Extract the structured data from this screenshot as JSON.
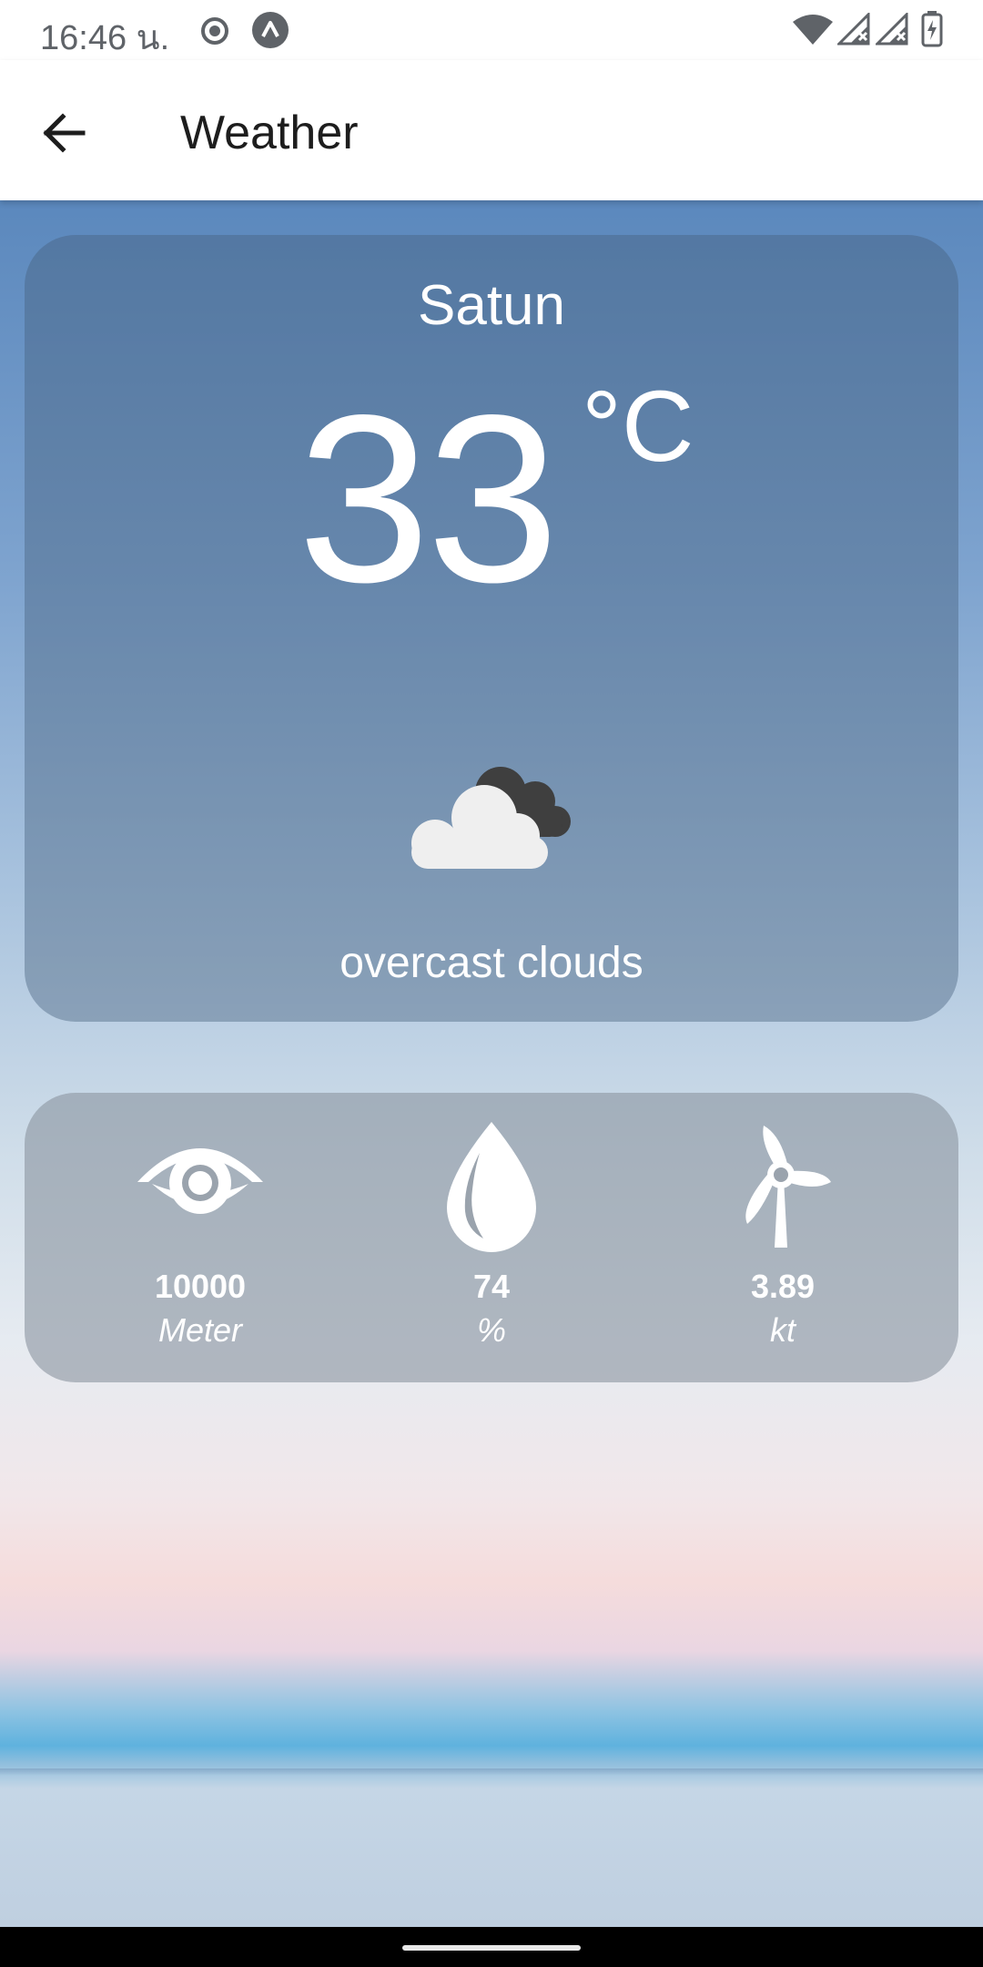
{
  "status_bar": {
    "time": "16:46 น.",
    "icons": [
      "record-icon",
      "vpn-arrow-icon",
      "wifi-icon",
      "signal-x-icon",
      "signal-x-icon",
      "battery-charging-icon"
    ]
  },
  "app_bar": {
    "title": "Weather",
    "back_icon": "arrow-left-icon"
  },
  "weather": {
    "city": "Satun",
    "temperature": "33",
    "unit": "°C",
    "condition_icon": "overcast-clouds-icon",
    "description": "overcast clouds"
  },
  "stats": [
    {
      "icon": "eye-icon",
      "value": "10000",
      "unit": "Meter"
    },
    {
      "icon": "water-drop-icon",
      "value": "74",
      "unit": "%"
    },
    {
      "icon": "wind-turbine-icon",
      "value": "3.89",
      "unit": "kt"
    }
  ],
  "colors": {
    "card_overlay": "#465f7d",
    "text_on_card": "#ffffff",
    "app_bar_bg": "#ffffff",
    "title_text": "#1d1d1d"
  }
}
